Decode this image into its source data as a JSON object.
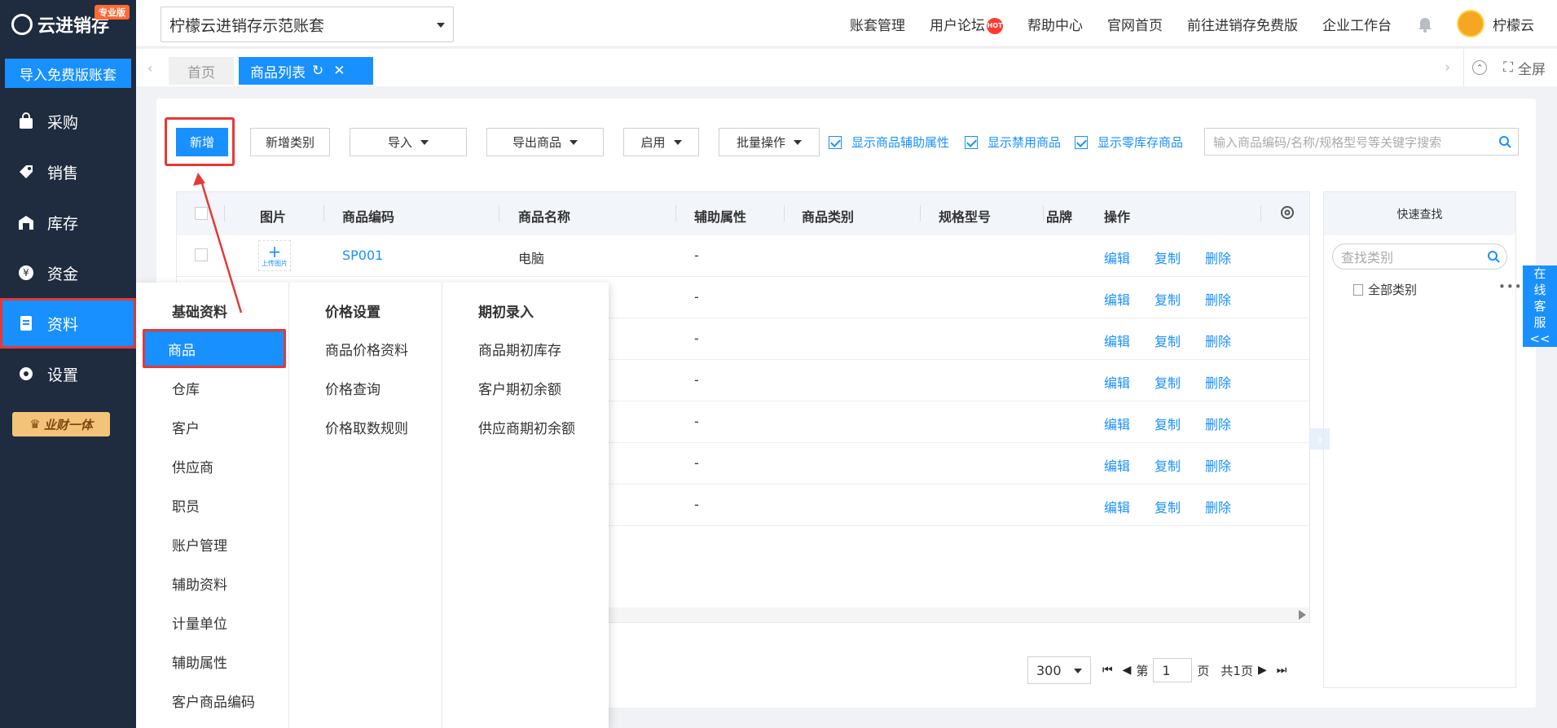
{
  "logo": {
    "text": "云进销存",
    "badge": "专业版"
  },
  "sidebar": {
    "import_button": "导入免费版账套",
    "items": [
      {
        "label": "采购",
        "icon": "shopping-bag-icon"
      },
      {
        "label": "销售",
        "icon": "sales-tag-icon"
      },
      {
        "label": "库存",
        "icon": "warehouse-icon"
      },
      {
        "label": "资金",
        "icon": "yen-coin-icon"
      },
      {
        "label": "资料",
        "icon": "document-icon",
        "active": true
      },
      {
        "label": "设置",
        "icon": "gear-icon"
      }
    ],
    "vip_label": "业财一体"
  },
  "header": {
    "account": "柠檬云进销存示范账套",
    "links": [
      "账套管理",
      "用户论坛",
      "帮助中心",
      "官网首页",
      "前往进销存免费版",
      "企业工作台"
    ],
    "hot_badge": "HOT",
    "username": "柠檬云"
  },
  "tabs": {
    "home": "首页",
    "active": "商品列表",
    "fullscreen": "全屏"
  },
  "toolbar": {
    "add": "新增",
    "add_category": "新增类别",
    "import": "导入",
    "export": "导出商品",
    "enable": "启用",
    "batch": "批量操作",
    "checks": [
      "显示商品辅助属性",
      "显示禁用商品",
      "显示零库存商品"
    ],
    "search_placeholder": "输入商品编码/名称/规格型号等关键字搜索"
  },
  "table": {
    "headers": [
      "图片",
      "商品编码",
      "商品名称",
      "辅助属性",
      "商品类别",
      "规格型号",
      "品牌",
      "操作"
    ],
    "upload_label": "上传图片",
    "rows": [
      {
        "code": "SP001",
        "name": "电脑",
        "attr": "-"
      },
      {
        "attr": "-"
      },
      {
        "attr": "-"
      },
      {
        "attr": "-"
      },
      {
        "attr": "-"
      },
      {
        "attr": "-"
      },
      {
        "attr": "-"
      }
    ],
    "actions": [
      "编辑",
      "复制",
      "删除"
    ]
  },
  "pager": {
    "page_size": "300",
    "page_prefix": "第",
    "current": "1",
    "page_suffix": "页",
    "total": "共1页"
  },
  "quick": {
    "title": "快速查找",
    "search_placeholder": "查找类别",
    "all_categories": "全部类别"
  },
  "mega_menu": {
    "col1": {
      "title": "基础资料",
      "items": [
        "商品",
        "仓库",
        "客户",
        "供应商",
        "职员",
        "账户管理",
        "辅助资料",
        "计量单位",
        "辅助属性",
        "客户商品编码"
      ]
    },
    "col2": {
      "title": "价格设置",
      "items": [
        "商品价格资料",
        "价格查询",
        "价格取数规则"
      ]
    },
    "col3": {
      "title": "期初录入",
      "items": [
        "商品期初库存",
        "客户期初余额",
        "供应商期初余额"
      ]
    }
  },
  "service": {
    "label": [
      "在",
      "线",
      "客",
      "服",
      "<<"
    ]
  },
  "colors": {
    "primary": "#1890ff",
    "sidebar": "#1f2b3e",
    "highlight": "#e53935"
  }
}
